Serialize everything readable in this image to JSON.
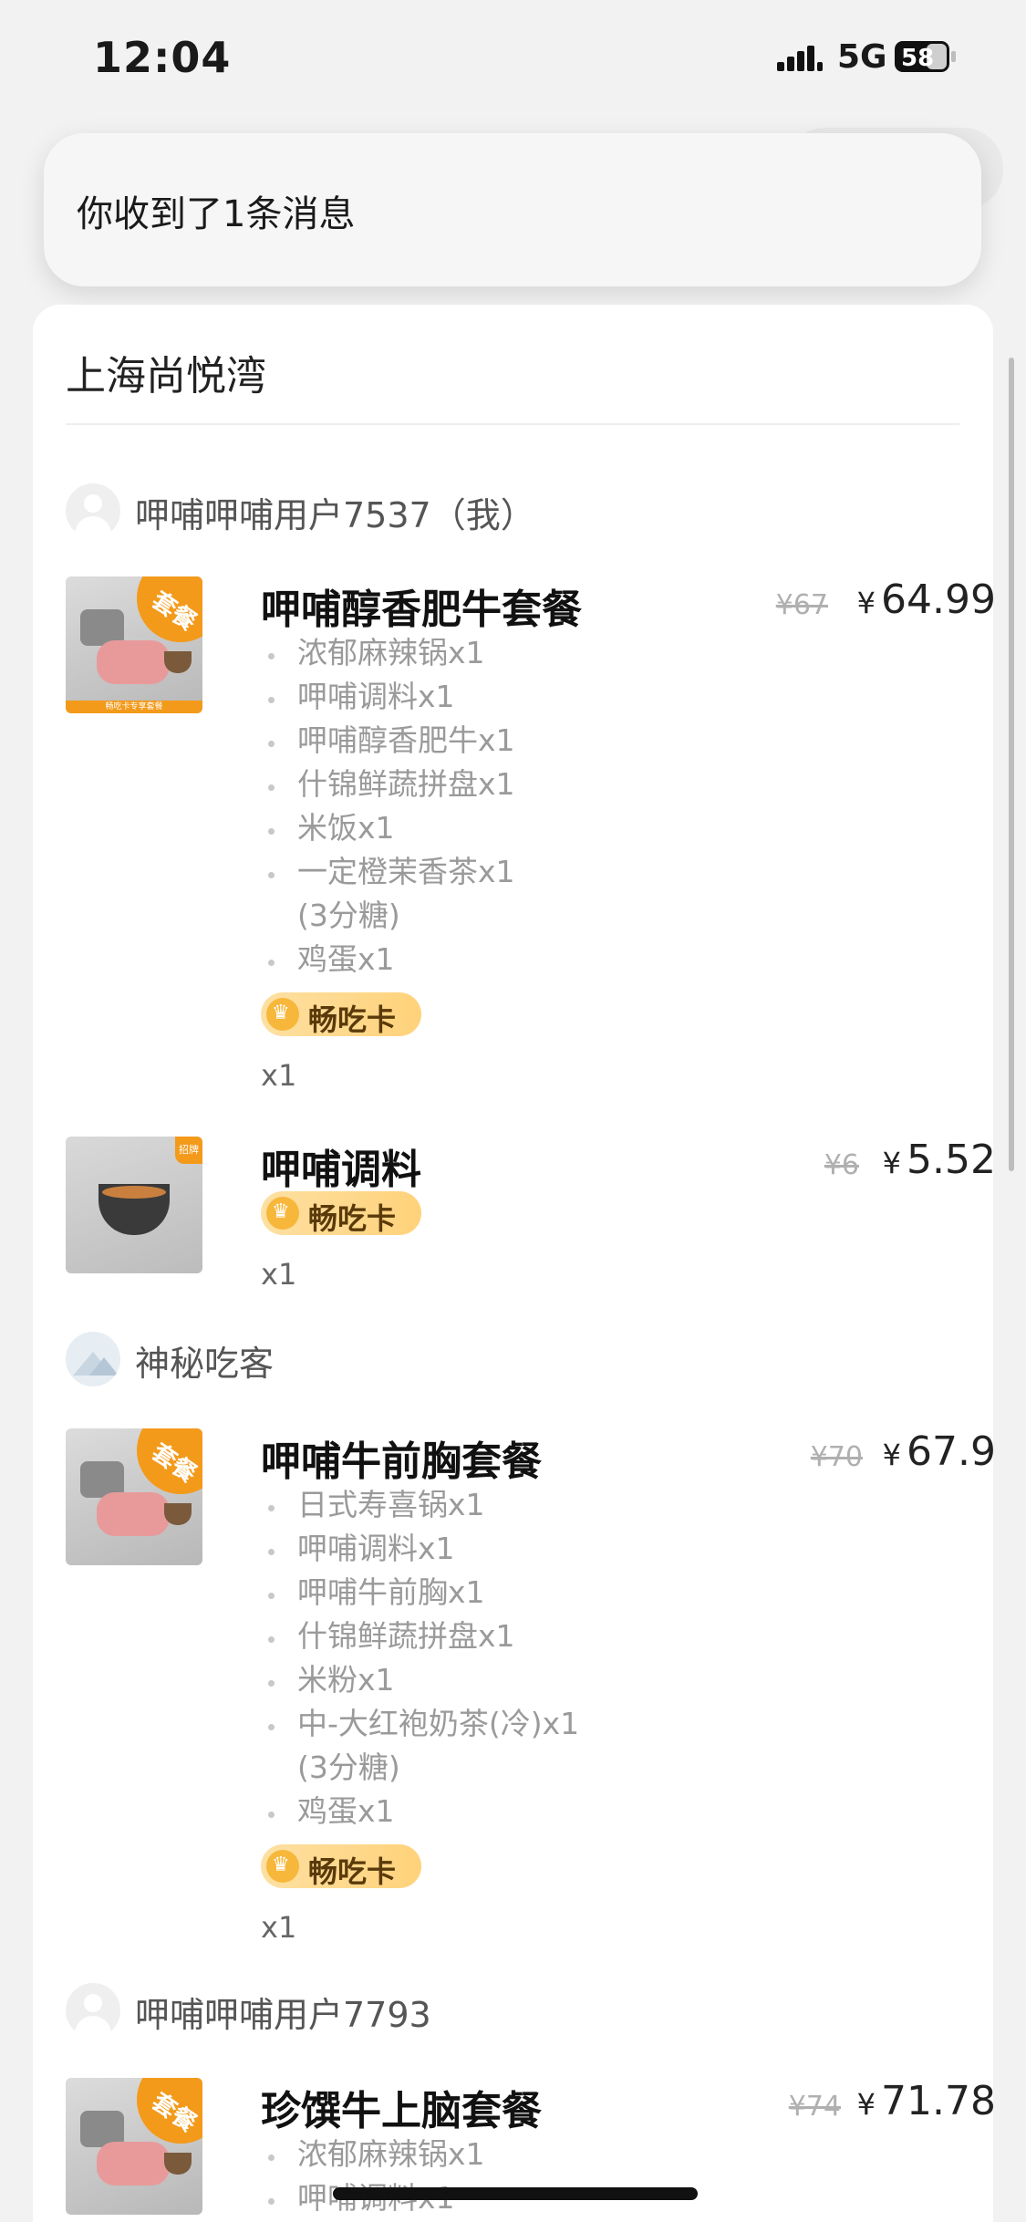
{
  "status_bar": {
    "time": "12:04",
    "network": "5G",
    "battery": "58",
    "signal_icon": "signal-bars-icon",
    "battery_icon": "battery-icon"
  },
  "notification": {
    "message": "你收到了1条消息"
  },
  "store": {
    "name": "上海尚悦湾"
  },
  "groups": [
    {
      "user": "呷哺呷哺用户7537（我）",
      "items": [
        {
          "title": "呷哺醇香肥牛套餐",
          "old_price": "¥67",
          "price": "64.99",
          "corner_label": "套餐",
          "strip_label": "畅吃卡专享套餐",
          "subs": [
            "浓郁麻辣锅x1",
            "呷哺调料x1",
            "呷哺醇香肥牛x1",
            "什锦鲜蔬拼盘x1",
            "米饭x1",
            "一定橙茉香茶x1",
            "(3分糖)",
            "鸡蛋x1"
          ],
          "badge": "畅吃卡",
          "qty": "x1"
        },
        {
          "title": "呷哺调料",
          "old_price": "¥6",
          "price": "5.52",
          "corner_label": "招牌",
          "badge": "畅吃卡",
          "qty": "x1"
        }
      ]
    },
    {
      "user": "神秘吃客",
      "items": [
        {
          "title": "呷哺牛前胸套餐",
          "old_price": "¥70",
          "price": "67.9",
          "corner_label": "套餐",
          "subs": [
            "日式寿喜锅x1",
            "呷哺调料x1",
            "呷哺牛前胸x1",
            "什锦鲜蔬拼盘x1",
            "米粉x1",
            "中-大红袍奶茶(冷)x1",
            "(3分糖)",
            "鸡蛋x1"
          ],
          "badge": "畅吃卡",
          "qty": "x1"
        }
      ]
    },
    {
      "user": "呷哺呷哺用户7793",
      "items": [
        {
          "title": "珍馔牛上脑套餐",
          "old_price": "¥74",
          "price": "71.78",
          "corner_label": "套餐",
          "subs": [
            "浓郁麻辣锅x1",
            "呷哺调料x1"
          ]
        }
      ]
    }
  ],
  "currency": "¥",
  "colors": {
    "accent": "#f39a1b",
    "badge_bg": "#ffd27a",
    "text_primary": "#111111",
    "text_secondary": "#9a9a9a"
  }
}
